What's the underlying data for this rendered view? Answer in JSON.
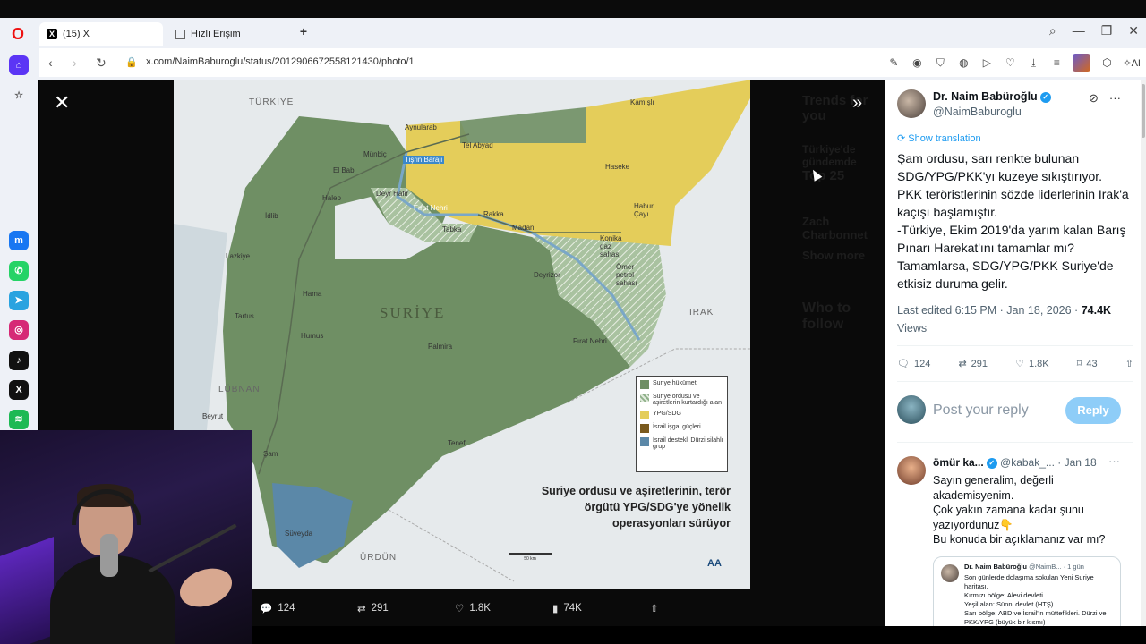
{
  "browser": {
    "tabs": [
      {
        "label": "(15) X"
      },
      {
        "label": "Hızlı Erişim"
      }
    ],
    "url": "x.com/NaimBaburoglu/status/2012906672558121430/photo/1",
    "ai_label": "AI",
    "icons": [
      "opera-logo",
      "back",
      "forward",
      "reload",
      "lock",
      "edit",
      "camera",
      "shield",
      "extension",
      "play",
      "heart",
      "download",
      "menu",
      "profile",
      "box",
      "ai"
    ]
  },
  "sidebar": {
    "items": [
      "home-icon",
      "star-icon",
      "messenger-icon",
      "whatsapp-icon",
      "telegram-icon",
      "instagram-icon",
      "tiktok-icon",
      "x-icon",
      "spotify-icon"
    ]
  },
  "viewer": {
    "ghost_items": [
      "Trends for you",
      "Türkiye'de gündemde",
      "Top 25",
      "Zach Charbonnet",
      "Show more",
      "Who to follow"
    ],
    "actions": {
      "replies": "124",
      "reposts": "291",
      "likes": "1.8K",
      "views": "74K"
    }
  },
  "map": {
    "labels": {
      "turkiye": "TÜRKİYE",
      "lubnan": "LÜBNAN",
      "irak": "IRAK",
      "urdun": "ÜRDÜN",
      "suriye": "SURİYE",
      "kamisli": "Kamışlı",
      "aynularab": "Aynularab",
      "telabyad": "Tel Abyad",
      "munbic": "Münbiç",
      "tisrin": "Tişrin Barajı",
      "elbab": "El Bab",
      "halep": "Halep",
      "deyrhafir": "Deyr Hafir",
      "idlib": "İdlib",
      "firat": "Fırat Nehri",
      "rakka": "Rakka",
      "tabka": "Tabka",
      "maadan": "Madan",
      "haseke": "Haseke",
      "habur": "Habur Çayı",
      "konika": "Konika gaz sahası",
      "omer": "Ömer petrol sahası",
      "deyrizor": "Deyrizor",
      "firat2": "Fırat Nehri",
      "lazkiye": "Lazkiye",
      "hama": "Hama",
      "tartus": "Tartus",
      "humus": "Humus",
      "palmira": "Palmira",
      "beyrut": "Beyrut",
      "sam": "Şam",
      "tenef": "Tenef",
      "suveyda": "Süveyda",
      "scale": "50 km"
    },
    "legend": [
      {
        "label": "Suriye hükümeti",
        "color": "#6f8f64"
      },
      {
        "label": "Suriye ordusu ve aşiretlerin kurtardığı alan",
        "color": "#8fb08a"
      },
      {
        "label": "YPG/SDG",
        "color": "#e4cd5a"
      },
      {
        "label": "İsrail işgal güçleri",
        "color": "#7a5a1e"
      },
      {
        "label": "İsrail destekli Dürzi silahlı grup",
        "color": "#5b88a8"
      }
    ],
    "caption": "Suriye ordusu ve aşiretlerinin, terör örgütü YPG/SDG'ye yönelik operasyonları sürüyor",
    "logo": "AA"
  },
  "tweet": {
    "author_name": "Dr. Naim Babüroğlu",
    "author_handle": "@NaimBaburoglu",
    "translate_label": "Show translation",
    "body": "Şam ordusu, sarı renkte bulunan SDG/YPG/PKK'yı kuzeye sıkıştırıyor.\nPKK teröristlerinin sözde liderlerinin Irak'a kaçışı başlamıştır.\n-Türkiye, Ekim 2019'da yarım kalan Barış Pınarı Harekat'ını tamamlar mı?\nTamamlarsa, SDG/YPG/PKK Suriye'de etkisiz duruma gelir.",
    "edited": "Last edited 6:15 PM · Jan 18, 2026 ·",
    "view_count": "74.4K",
    "views_label": "Views",
    "stats": {
      "replies": "124",
      "reposts": "291",
      "likes": "1.8K",
      "bookmarks": "43"
    },
    "reply_placeholder": "Post your reply",
    "reply_button": "Reply"
  },
  "reply": {
    "name": "ömür ka...",
    "handle": "@kabak_...",
    "date": "· Jan 18",
    "body": "Sayın generalim, değerli akademisyenim.\nÇok yakın zamana kadar şunu yazıyordunuz👇\nBu konuda bir açıklamanız var mı?",
    "quote": {
      "name": "Dr. Naim Babüroğlu",
      "handle": "@NaimB...",
      "date": "· 1 gün",
      "lines": [
        "Son günlerde dolaşıma sokulan Yeni Suriye haritası.",
        "Kırmızı bölge: Alevi devleti",
        "Yeşil alan: Sünni devlet (HTŞ)",
        "Sarı bölge: ABD ve İsrail'in müttefikleri. Dürzi ve PKK/YPG (büyük bir kısmı)"
      ]
    }
  },
  "colors": {
    "accent": "#1d9bf0",
    "government": "#6f8f64",
    "sdg": "#e4cd5a",
    "druze": "#5b88a8"
  }
}
